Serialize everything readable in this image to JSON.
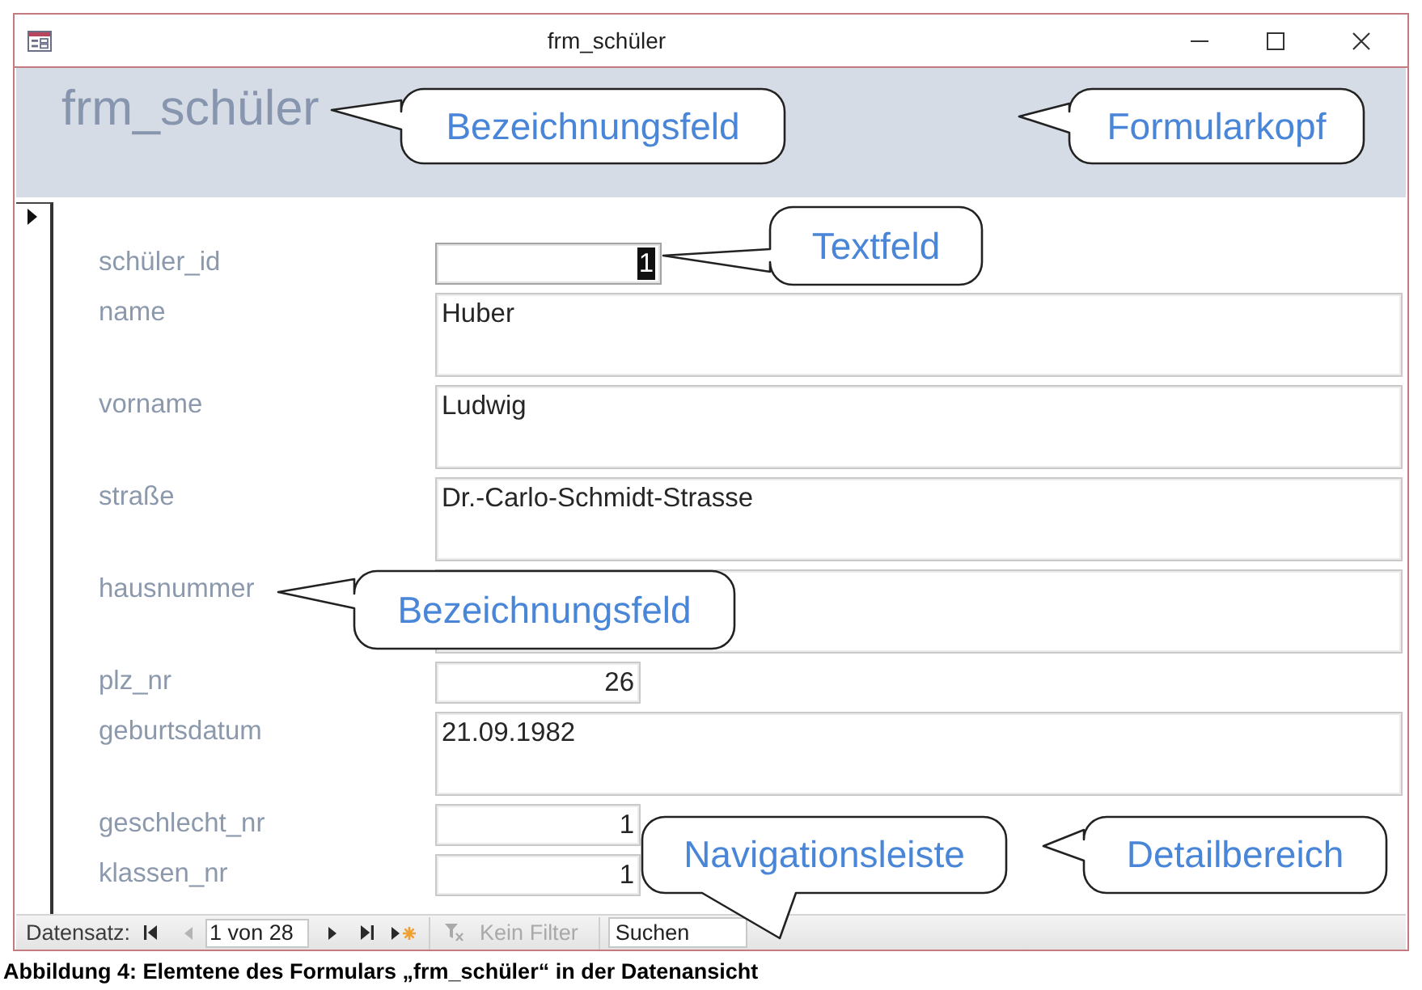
{
  "window": {
    "title": "frm_schüler"
  },
  "header": {
    "title": "frm_schüler"
  },
  "fields": [
    {
      "label": "schüler_id",
      "kind": "id",
      "value": "1",
      "focused": true
    },
    {
      "label": "name",
      "kind": "text",
      "value": "Huber",
      "focused": false
    },
    {
      "label": "vorname",
      "kind": "text",
      "value": "Ludwig",
      "focused": false
    },
    {
      "label": "straße",
      "kind": "text",
      "value": "Dr.-Carlo-Schmidt-Strasse",
      "focused": false
    },
    {
      "label": "hausnummer",
      "kind": "text",
      "focused": false
    },
    {
      "label": "plz_nr",
      "kind": "number",
      "value": "26",
      "focused": false
    },
    {
      "label": "geburtsdatum",
      "kind": "text",
      "value": "21.09.1982",
      "focused": false
    },
    {
      "label": "geschlecht_nr",
      "kind": "number",
      "value": "1",
      "focused": false
    },
    {
      "label": "klassen_nr",
      "kind": "number",
      "value": "1",
      "focused": false
    }
  ],
  "navigation": {
    "label": "Datensatz:",
    "items": [
      {
        "kind": "first",
        "disabled": false
      },
      {
        "kind": "previous",
        "disabled": true
      },
      {
        "kind": "position",
        "value": "1 von 28",
        "disabled": false
      },
      {
        "kind": "next",
        "disabled": false
      },
      {
        "kind": "last",
        "disabled": false
      },
      {
        "kind": "new",
        "disabled": false
      }
    ],
    "filter": {
      "label": "Kein Filter",
      "disabled": true
    },
    "search": {
      "placeholder": "Suchen"
    }
  },
  "callouts": [
    {
      "text": "Bezeichnungsfeld",
      "kind": "left"
    },
    {
      "text": "Formularkopf",
      "kind": "left"
    },
    {
      "text": "Textfeld",
      "kind": "left"
    },
    {
      "text": "Bezeichnungsfeld",
      "kind": "left"
    },
    {
      "text": "Navigationsleiste",
      "kind": "down"
    },
    {
      "text": "Detailbereich",
      "kind": "left"
    }
  ],
  "caption": "Abbildung 4: Elemtene des Formulars „frm_schüler“ in der Datenansicht"
}
